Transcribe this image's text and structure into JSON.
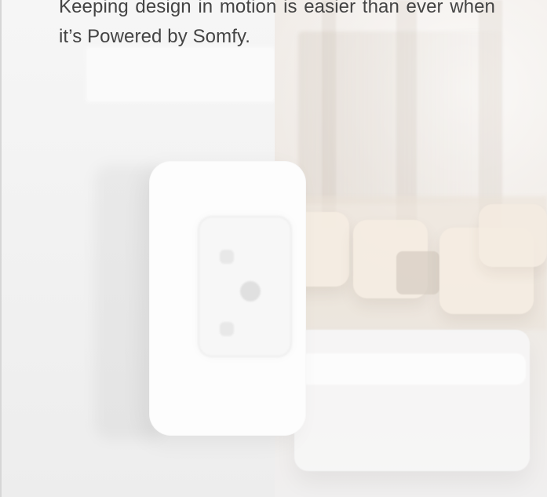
{
  "content": {
    "intro_paragraph": "Keeping design in motion is easier than ever when it’s Powered by Somfy."
  },
  "colors": {
    "text": "#444444",
    "left_background": "#f2f2f2",
    "right_background": "#ece6e0",
    "border": "#d6d6d6"
  }
}
